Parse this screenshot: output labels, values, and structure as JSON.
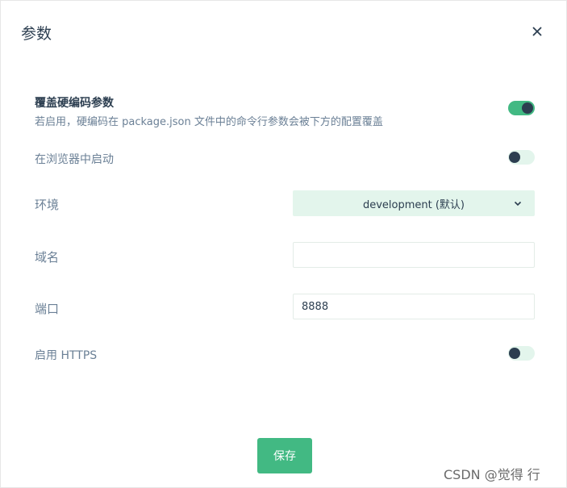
{
  "dialog": {
    "title": "参数",
    "close_icon": "close-icon"
  },
  "settings": {
    "override": {
      "label": "覆盖硬编码参数",
      "description": "若启用，硬编码在 package.json 文件中的命令行参数会被下方的配置覆盖",
      "enabled": true
    },
    "open_browser": {
      "label": "在浏览器中启动",
      "enabled": false
    },
    "environment": {
      "label": "环境",
      "selected": "development (默认)",
      "chevron_icon": "chevron-down-icon"
    },
    "domain": {
      "label": "域名",
      "value": ""
    },
    "port": {
      "label": "端口",
      "value": "8888"
    },
    "https": {
      "label": "启用 HTTPS",
      "enabled": false
    }
  },
  "actions": {
    "save_label": "保存"
  },
  "watermark": "CSDN @觉得 行",
  "colors": {
    "accent": "#42b983",
    "accent_light": "#e3f5ec",
    "text_dark": "#2c3e50",
    "text_muted": "#6b8096"
  }
}
